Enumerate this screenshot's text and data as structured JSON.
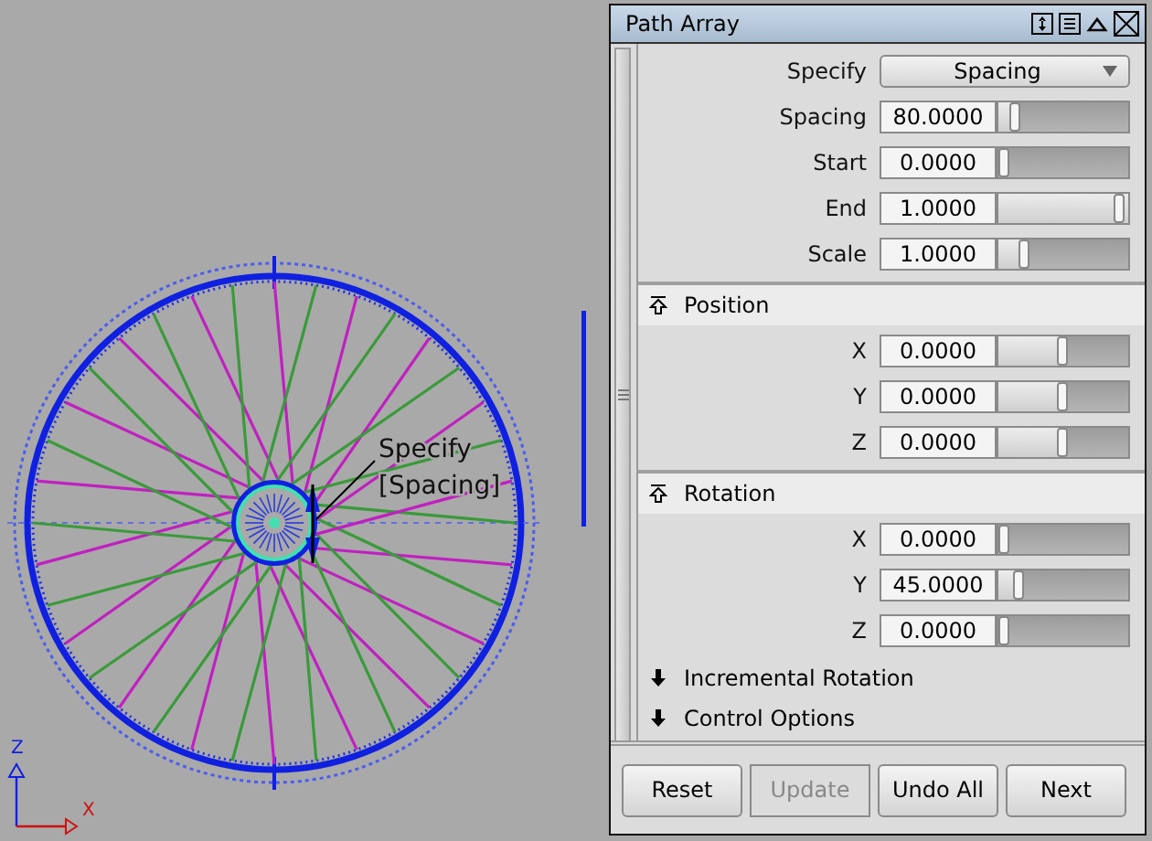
{
  "viewport": {
    "annotation_lines": [
      "Specify",
      "[Spacing]"
    ],
    "axis_labels": [
      "Z",
      "X"
    ]
  },
  "panel": {
    "title": "Path Array",
    "params": [
      {
        "kind": "dropdown",
        "label": "Specify",
        "value": "Spacing"
      },
      {
        "kind": "slider",
        "label": "Spacing",
        "value": "80.0000",
        "level": 0.1
      },
      {
        "kind": "slider",
        "label": "Start",
        "value": "0.0000",
        "level": 0
      },
      {
        "kind": "slider",
        "label": "End",
        "value": "1.0000",
        "level": 1
      },
      {
        "kind": "slider",
        "label": "Scale",
        "value": "1.0000",
        "level": 0.18
      }
    ],
    "sections": [
      {
        "title": "Position",
        "expanded": true,
        "rows": [
          {
            "label": "X",
            "value": "0.0000",
            "level": 0.5
          },
          {
            "label": "Y",
            "value": "0.0000",
            "level": 0.5
          },
          {
            "label": "Z",
            "value": "0.0000",
            "level": 0.5
          }
        ]
      },
      {
        "title": "Rotation",
        "expanded": true,
        "rows": [
          {
            "label": "X",
            "value": "0.0000",
            "level": 0
          },
          {
            "label": "Y",
            "value": "45.0000",
            "level": 0.125
          },
          {
            "label": "Z",
            "value": "0.0000",
            "level": 0
          }
        ]
      },
      {
        "title": "Incremental Rotation",
        "expanded": false
      },
      {
        "title": "Control Options",
        "expanded": false
      }
    ],
    "buttons": [
      {
        "label": "Reset",
        "disabled": false
      },
      {
        "label": "Update",
        "disabled": true
      },
      {
        "label": "Undo All",
        "disabled": false
      },
      {
        "label": "Next",
        "disabled": false
      }
    ]
  }
}
